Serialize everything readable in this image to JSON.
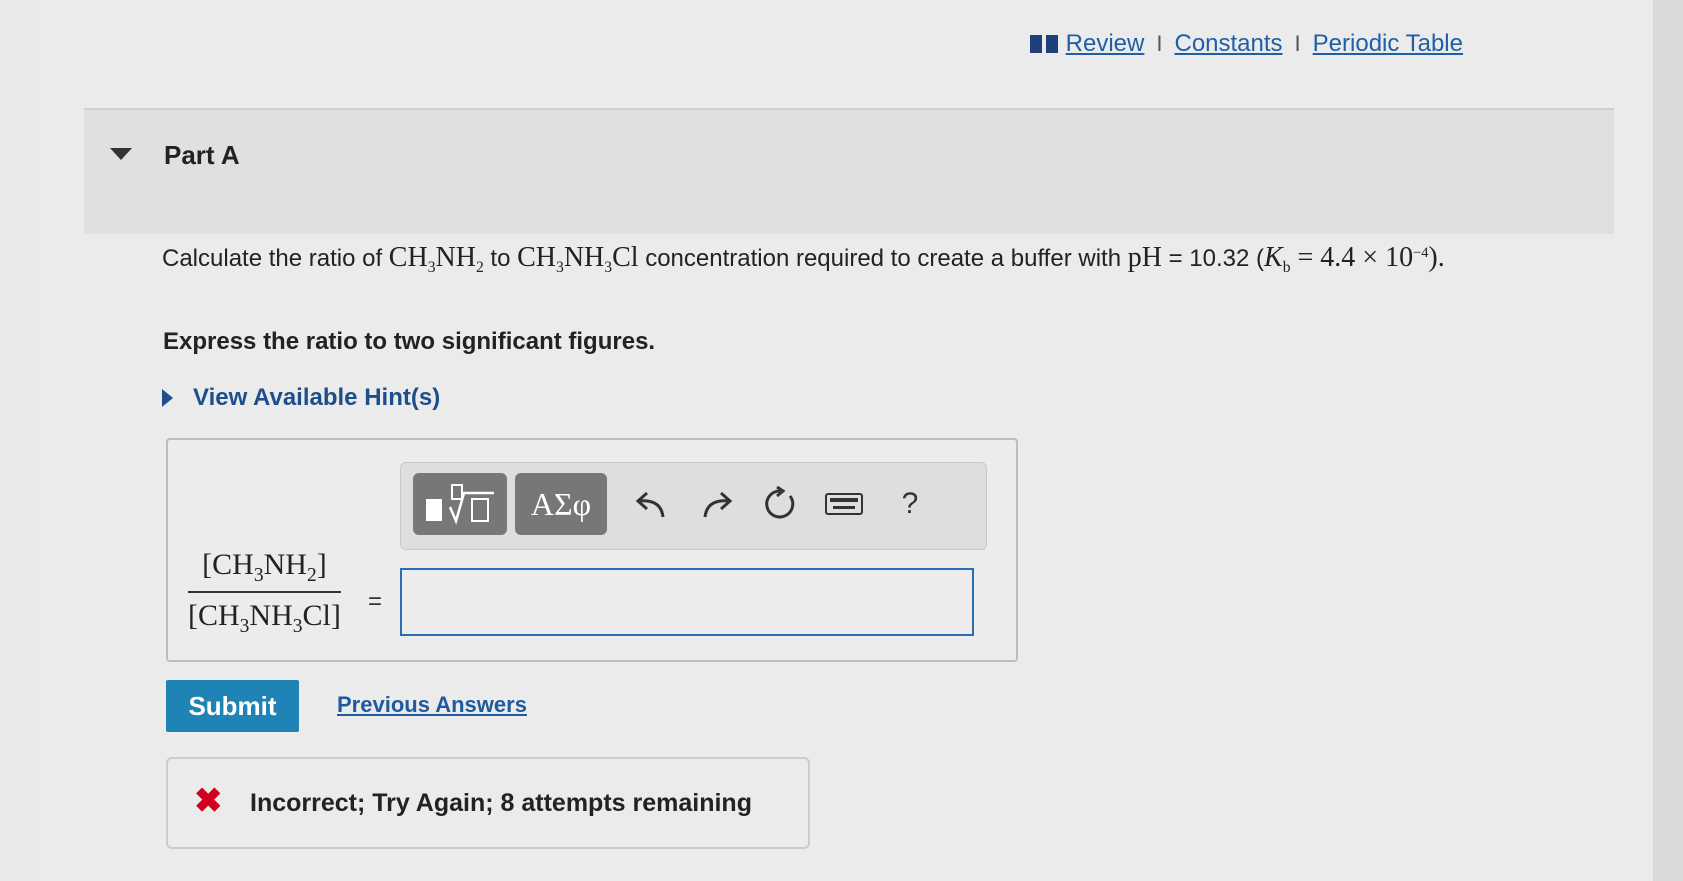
{
  "links": {
    "review": "Review",
    "constants": "Constants",
    "periodic_table": "Periodic Table",
    "separator": "I"
  },
  "part": {
    "title": "Part A"
  },
  "question": {
    "text_1": "Calculate the ratio of ",
    "species_1": "CH",
    "species_1_sub_a": "3",
    "species_1_mid": "NH",
    "species_1_sub_b": "2",
    "text_2": " to ",
    "species_2": "CH",
    "species_2_sub_a": "3",
    "species_2_mid": "NH",
    "species_2_sub_b": "3",
    "species_2_end": "Cl",
    "text_3": " concentration required to create a buffer with ",
    "ph": "pH",
    "ph_value": " = 10.32 (",
    "kb": "K",
    "kb_sub": "b",
    "kb_value": " = 4.4 × 10",
    "kb_exp": "−4",
    "close": ")."
  },
  "instruction": "Express the ratio to two significant figures.",
  "hints_label": "View Available Hint(s)",
  "toolbar": {
    "greek_label": "ΑΣφ",
    "help_label": "?"
  },
  "fraction": {
    "num_a": "[CH",
    "num_sub_a": "3",
    "num_b": "NH",
    "num_sub_b": "2",
    "num_c": "]",
    "den_a": "[CH",
    "den_sub_a": "3",
    "den_b": "NH",
    "den_sub_b": "3",
    "den_c": "Cl]",
    "equals": "="
  },
  "answer_value": "",
  "buttons": {
    "submit": "Submit",
    "previous_answers": "Previous Answers"
  },
  "feedback": {
    "icon": "✖",
    "text": "Incorrect; Try Again; 8 attempts remaining"
  },
  "colors": {
    "link": "#1f5fa8",
    "submit_bg": "#1f83b5",
    "error": "#d0021b"
  }
}
